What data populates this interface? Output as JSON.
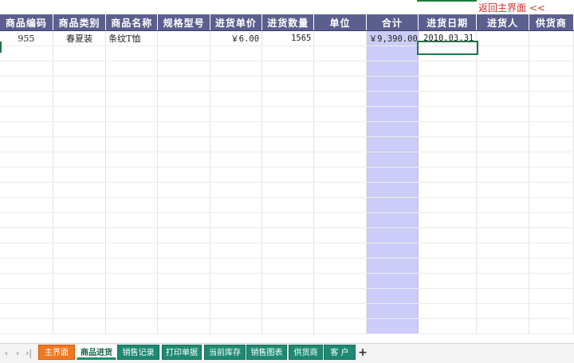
{
  "back_link": "返回主界面 <<",
  "columns": [
    {
      "key": "code",
      "label": "商品编码"
    },
    {
      "key": "category",
      "label": "商品类别"
    },
    {
      "key": "name",
      "label": "商品名称"
    },
    {
      "key": "spec",
      "label": "规格型号"
    },
    {
      "key": "unit_price",
      "label": "进货单价"
    },
    {
      "key": "qty",
      "label": "进货数量"
    },
    {
      "key": "unit",
      "label": "单位"
    },
    {
      "key": "total",
      "label": "合计"
    },
    {
      "key": "date",
      "label": "进货日期"
    },
    {
      "key": "buyer",
      "label": "进货人"
    },
    {
      "key": "supplier",
      "label": "供货商"
    }
  ],
  "rows": [
    {
      "code": "955",
      "category": "春夏装",
      "name": "条纹T恤",
      "spec": "",
      "unit_price": "￥6.00",
      "qty": "1565",
      "unit": "",
      "total": "￥9,390.00",
      "date": "2010.03.31",
      "buyer": "",
      "supplier": ""
    }
  ],
  "tabs": [
    {
      "label": "主界面",
      "style": "orange"
    },
    {
      "label": "商品进货",
      "style": "active"
    },
    {
      "label": "销售记录",
      "style": "teal"
    },
    {
      "label": "打印单据",
      "style": "teal"
    },
    {
      "label": "当前库存",
      "style": "teal"
    },
    {
      "label": "销售图表",
      "style": "teal"
    },
    {
      "label": "供货商",
      "style": "teal"
    },
    {
      "label": "客 户",
      "style": "teal"
    }
  ],
  "add_sheet": "+",
  "nav": [
    "‹",
    "›",
    "›|"
  ],
  "colors": {
    "header_bg": "#5b5f8e",
    "total_col_bg": "#ccccf8",
    "tab_teal": "#1f8a72",
    "tab_orange": "#f07820",
    "back_link": "#d0302a",
    "selection": "#217346"
  }
}
